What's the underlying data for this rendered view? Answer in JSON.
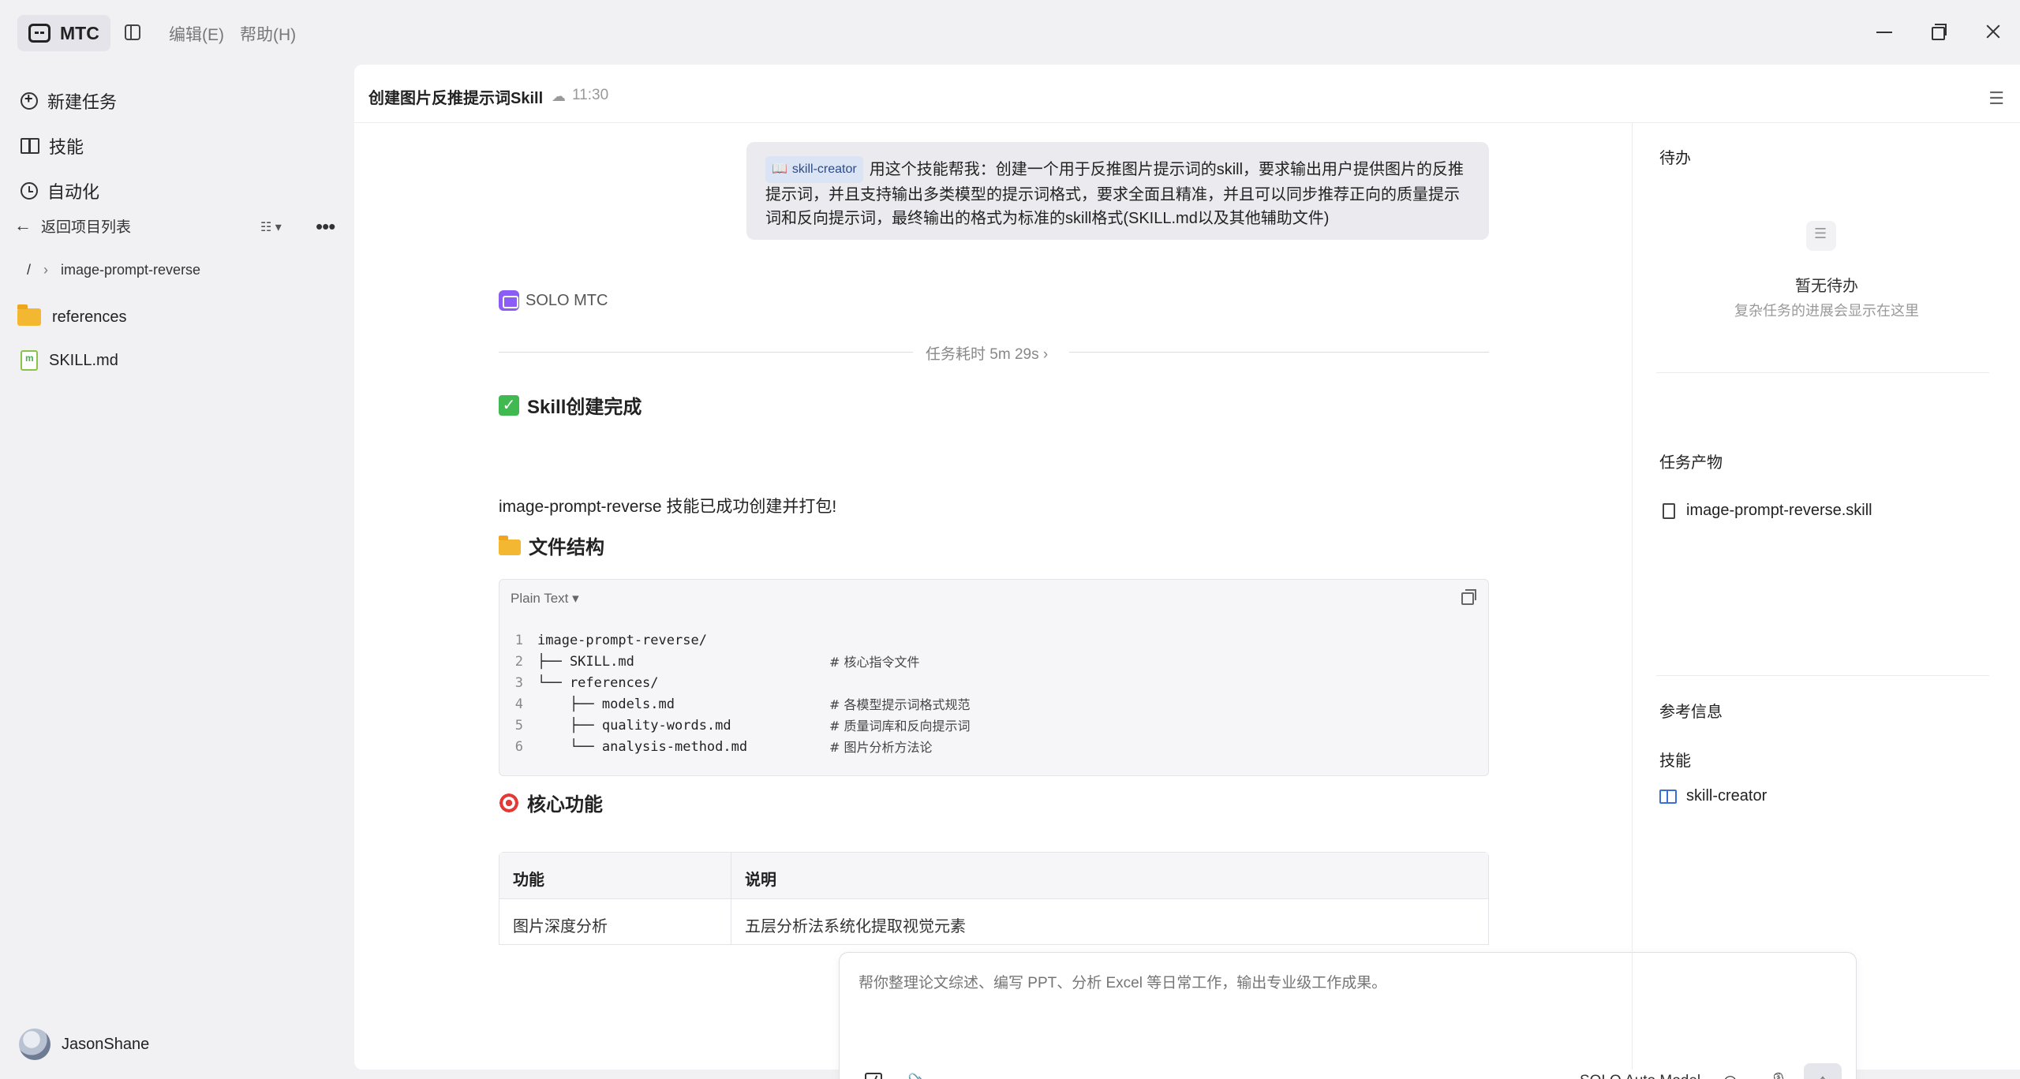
{
  "app": {
    "name": "MTC",
    "menus": [
      "编辑(E)",
      "帮助(H)"
    ]
  },
  "sidebar": {
    "nav": [
      {
        "label": "新建任务",
        "icon": "plus-circle-icon"
      },
      {
        "label": "技能",
        "icon": "book-icon"
      },
      {
        "label": "自动化",
        "icon": "clock-icon"
      }
    ],
    "back_label": "返回项目列表",
    "breadcrumb": {
      "root": "/",
      "folder": "image-prompt-reverse"
    },
    "files": [
      {
        "name": "references",
        "icon": "folder-icon"
      },
      {
        "name": "SKILL.md",
        "icon": "markdown-file-icon"
      }
    ],
    "user": {
      "name": "JasonShane"
    }
  },
  "header": {
    "title": "创建图片反推提示词Skill",
    "time": "11:30"
  },
  "conversation": {
    "user_message": {
      "chip": "skill-creator",
      "text": "用这个技能帮我：创建一个用于反推图片提示词的skill，要求输出用户提供图片的反推提示词，并且支持输出多类模型的提示词格式，要求全面且精准，并且可以同步推荐正向的质量提示词和反向提示词，最终输出的格式为标准的skill格式(SKILL.md以及其他辅助文件)"
    },
    "agent_name": "SOLO MTC",
    "duration": "任务耗时 5m 29s",
    "heading_done": "Skill创建完成",
    "result_name": "image-prompt-reverse",
    "result_text": " 技能已成功创建并打包!",
    "heading_structure": "文件结构",
    "code": {
      "language": "Plain Text",
      "lines": [
        {
          "num": "1",
          "text": "image-prompt-reverse/",
          "comment": ""
        },
        {
          "num": "2",
          "text": "├── SKILL.md",
          "comment": "# 核心指令文件"
        },
        {
          "num": "3",
          "text": "└── references/",
          "comment": ""
        },
        {
          "num": "4",
          "text": "    ├── models.md",
          "comment": "# 各模型提示词格式规范"
        },
        {
          "num": "5",
          "text": "    ├── quality-words.md",
          "comment": "# 质量词库和反向提示词"
        },
        {
          "num": "6",
          "text": "    └── analysis-method.md",
          "comment": "# 图片分析方法论"
        }
      ]
    },
    "heading_features": "核心功能",
    "table": {
      "headers": [
        "功能",
        "说明"
      ],
      "rows": [
        [
          "图片深度分析",
          "五层分析法系统化提取视觉元素"
        ]
      ]
    }
  },
  "composer": {
    "placeholder": "帮你整理论文综述、编写 PPT、分析 Excel 等日常工作，输出专业级工作成果。",
    "model": "SOLO Auto Model"
  },
  "right_panel": {
    "todo_title": "待办",
    "todo_empty_title": "暂无待办",
    "todo_empty_desc": "复杂任务的进展会显示在这里",
    "artifacts_title": "任务产物",
    "artifact_file": "image-prompt-reverse.skill",
    "reference_title": "参考信息",
    "skills_title": "技能",
    "skill_name": "skill-creator"
  }
}
